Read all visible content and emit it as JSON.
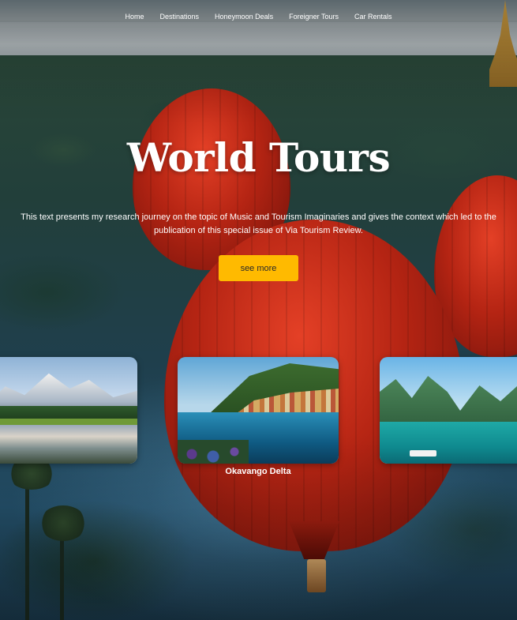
{
  "nav": {
    "items": [
      "Home",
      "Destinations",
      "Honeymoon Deals",
      "Foreigner Tours",
      "Car Rentals"
    ]
  },
  "hero": {
    "title": "World Tours",
    "description": "This text presents my research journey on the topic of Music and Tourism Imaginaries and gives the context which led to the publication of this special issue of Via Tourism Review.",
    "button_label": "see more"
  },
  "cards": [
    {
      "label": ""
    },
    {
      "label": "Okavango Delta"
    },
    {
      "label": ""
    }
  ],
  "colors": {
    "accent": "#ffba00",
    "text": "#ffffff"
  }
}
